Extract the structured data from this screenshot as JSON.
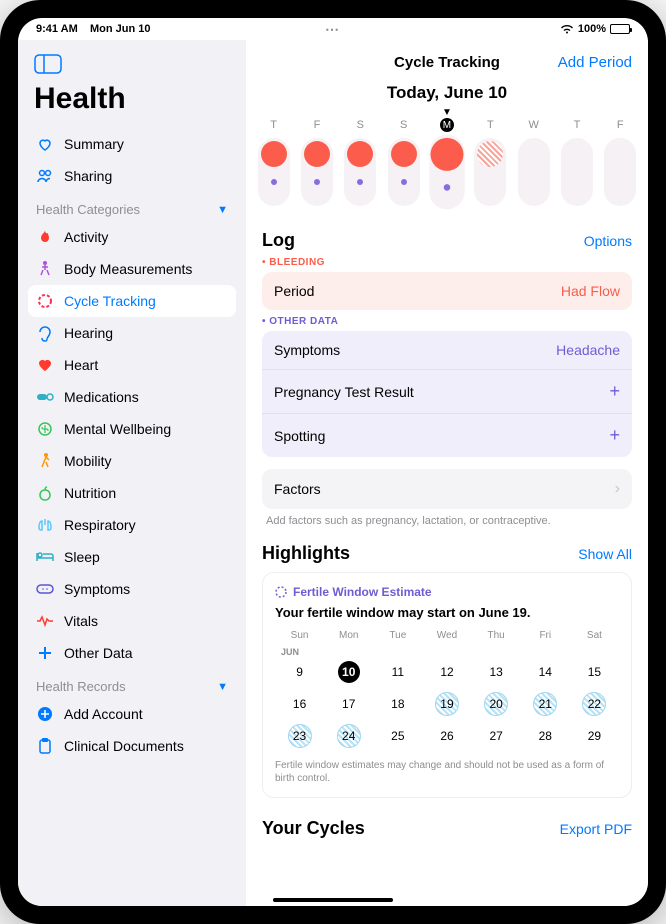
{
  "status": {
    "time": "9:41 AM",
    "date": "Mon Jun 10",
    "battery": "100%"
  },
  "sidebar": {
    "app": "Health",
    "top": [
      {
        "label": "Summary",
        "icon": "heart-outline"
      },
      {
        "label": "Sharing",
        "icon": "people"
      }
    ],
    "categories_label": "Health Categories",
    "categories": [
      {
        "label": "Activity",
        "icon": "flame",
        "color": "#ff3b30"
      },
      {
        "label": "Body Measurements",
        "icon": "figure",
        "color": "#af52de"
      },
      {
        "label": "Cycle Tracking",
        "icon": "cycle",
        "color": "#ff2d55",
        "active": true
      },
      {
        "label": "Hearing",
        "icon": "ear",
        "color": "#007aff"
      },
      {
        "label": "Heart",
        "icon": "heart",
        "color": "#ff3b30"
      },
      {
        "label": "Medications",
        "icon": "pills",
        "color": "#30b0c7"
      },
      {
        "label": "Mental Wellbeing",
        "icon": "brain",
        "color": "#34c759"
      },
      {
        "label": "Mobility",
        "icon": "walk",
        "color": "#ff9500"
      },
      {
        "label": "Nutrition",
        "icon": "apple",
        "color": "#34c759"
      },
      {
        "label": "Respiratory",
        "icon": "lungs",
        "color": "#5ac8fa"
      },
      {
        "label": "Sleep",
        "icon": "bed",
        "color": "#30b0c7"
      },
      {
        "label": "Symptoms",
        "icon": "bandage",
        "color": "#5856d6"
      },
      {
        "label": "Vitals",
        "icon": "waveform",
        "color": "#ff3b30"
      },
      {
        "label": "Other Data",
        "icon": "plus",
        "color": "#007aff"
      }
    ],
    "records_label": "Health Records",
    "records": [
      {
        "label": "Add Account",
        "icon": "add-circle",
        "color": "#007aff"
      },
      {
        "label": "Clinical Documents",
        "icon": "clipboard",
        "color": "#007aff"
      }
    ]
  },
  "main": {
    "title": "Cycle Tracking",
    "add_period": "Add Period",
    "today": "Today, June 10",
    "daystrip": [
      {
        "d": "T",
        "period": true,
        "purple": true
      },
      {
        "d": "F",
        "period": true,
        "purple": true
      },
      {
        "d": "S",
        "period": true,
        "purple": true
      },
      {
        "d": "S",
        "period": true,
        "purple": true
      },
      {
        "d": "M",
        "period": true,
        "purple": true,
        "today": true
      },
      {
        "d": "T",
        "hatch": true
      },
      {
        "d": "W"
      },
      {
        "d": "T"
      },
      {
        "d": "F"
      }
    ],
    "log": {
      "title": "Log",
      "options": "Options",
      "bleeding_label": "BLEEDING",
      "period_label": "Period",
      "period_value": "Had Flow",
      "other_label": "OTHER DATA",
      "symptoms_label": "Symptoms",
      "symptoms_value": "Headache",
      "preg_label": "Pregnancy Test Result",
      "spotting_label": "Spotting",
      "factors_label": "Factors",
      "factors_hint": "Add factors such as pregnancy, lactation, or contraceptive."
    },
    "highlights": {
      "title": "Highlights",
      "show_all": "Show All",
      "tag": "Fertile Window Estimate",
      "message": "Your fertile window may start on June 19.",
      "days": [
        "Sun",
        "Mon",
        "Tue",
        "Wed",
        "Thu",
        "Fri",
        "Sat"
      ],
      "month": "JUN",
      "grid": [
        {
          "n": 9
        },
        {
          "n": 10,
          "today": true
        },
        {
          "n": 11
        },
        {
          "n": 12
        },
        {
          "n": 13
        },
        {
          "n": 14
        },
        {
          "n": 15
        },
        {
          "n": 16
        },
        {
          "n": 17
        },
        {
          "n": 18
        },
        {
          "n": 19,
          "f": true
        },
        {
          "n": 20,
          "f": true
        },
        {
          "n": 21,
          "f": true
        },
        {
          "n": 22,
          "f": true
        },
        {
          "n": 23,
          "f": true
        },
        {
          "n": 24,
          "f": true
        },
        {
          "n": 25
        },
        {
          "n": 26
        },
        {
          "n": 27
        },
        {
          "n": 28
        },
        {
          "n": 29
        }
      ],
      "note": "Fertile window estimates may change and should not be used as a form of birth control."
    },
    "cycles_title": "Your Cycles",
    "export": "Export PDF"
  }
}
